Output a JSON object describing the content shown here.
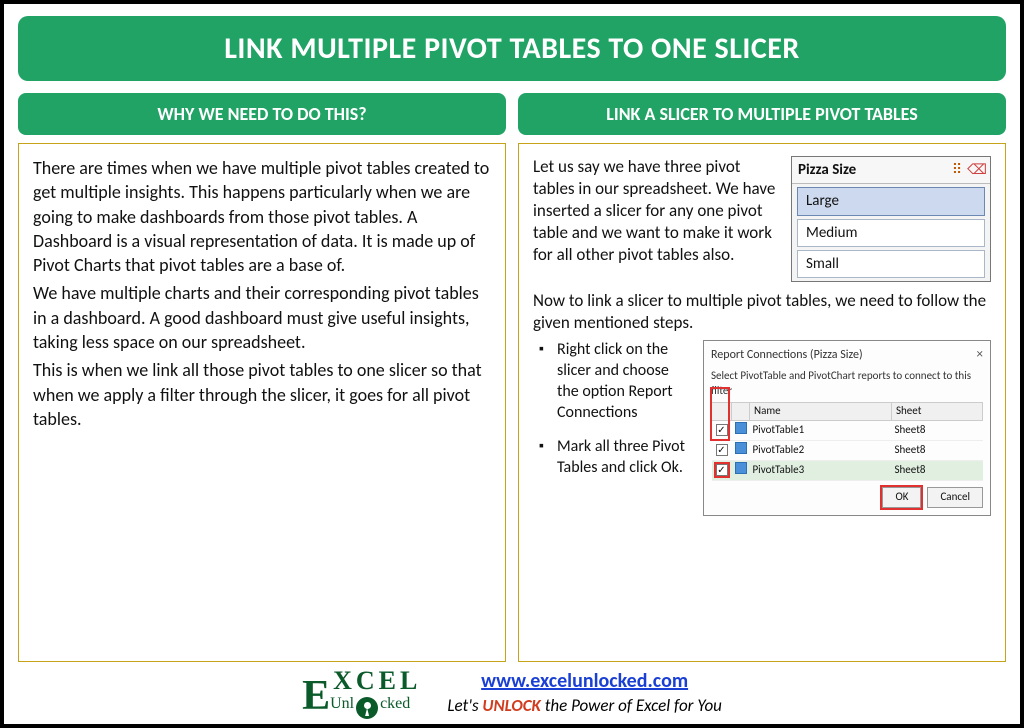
{
  "title": "LINK MULTIPLE PIVOT TABLES TO ONE SLICER",
  "left": {
    "header": "WHY WE NEED TO DO THIS?",
    "p1": "There are times when we have multiple pivot tables created to get multiple insights. This happens particularly when we are going to make dashboards from those pivot tables. A Dashboard is a visual representation of data. It is made up of Pivot Charts that pivot tables are a base of.",
    "p2": "We have multiple charts and their corresponding pivot tables in a dashboard. A good dashboard must give useful insights, taking less space on our spreadsheet.",
    "p3": "This is when we link all those pivot tables to one slicer so that when we apply a filter through the slicer, it goes for all pivot tables."
  },
  "right": {
    "header": "LINK A SLICER TO MULTIPLE PIVOT TABLES",
    "intro": "Let us say we have three pivot tables in our spreadsheet. We have inserted a slicer for any one pivot table and we want to make it work for all other pivot tables also.",
    "slicer": {
      "title": "Pizza Size",
      "items": [
        "Large",
        "Medium",
        "Small"
      ],
      "selected_index": 0
    },
    "lead": "Now to link a slicer to multiple pivot tables, we need to follow the given mentioned steps.",
    "steps": [
      "Right click on the slicer and choose the option Report Connections",
      "Mark all three Pivot Tables and click Ok."
    ],
    "dialog": {
      "title": "Report Connections (Pizza Size)",
      "subtitle": "Select PivotTable and PivotChart reports to connect to this filter",
      "col_name": "Name",
      "col_sheet": "Sheet",
      "rows": [
        {
          "name": "PivotTable1",
          "sheet": "Sheet8",
          "checked": true
        },
        {
          "name": "PivotTable2",
          "sheet": "Sheet8",
          "checked": true
        },
        {
          "name": "PivotTable3",
          "sheet": "Sheet8",
          "checked": true
        }
      ],
      "ok": "OK",
      "cancel": "Cancel",
      "close": "×"
    }
  },
  "footer": {
    "logo_top": "XCEL",
    "logo_e": "E",
    "logo_sub": "Unlocked",
    "url": "www.excelunlocked.com",
    "tag_pre": "Let's ",
    "tag_unlock": "UNLOCK",
    "tag_post": " the Power of Excel for You"
  }
}
